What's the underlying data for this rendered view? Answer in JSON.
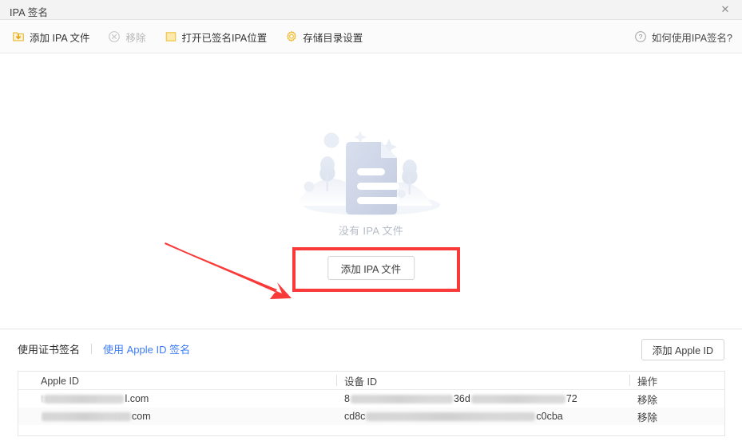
{
  "window": {
    "title": "IPA 签名",
    "close_label": "✕"
  },
  "toolbar": {
    "items": [
      {
        "label": "添加 IPA 文件",
        "icon": "import-file-icon",
        "disabled": false
      },
      {
        "label": "移除",
        "icon": "remove-circle-icon",
        "disabled": true
      },
      {
        "label": "打开已签名IPA位置",
        "icon": "folder-icon",
        "disabled": false
      },
      {
        "label": "存储目录设置",
        "icon": "gear-icon",
        "disabled": false
      }
    ],
    "help": {
      "label": "如何使用IPA签名?",
      "icon": "question-circle-icon"
    }
  },
  "empty_state": {
    "illustration": "empty-document-illustration",
    "message": "没有 IPA 文件",
    "add_button": "添加 IPA 文件"
  },
  "annotations": {
    "box_color": "#f93a39",
    "arrow_color": "#f93a39"
  },
  "bottom": {
    "tabs": [
      {
        "label": "使用证书签名",
        "active": false
      },
      {
        "label": "使用 Apple ID 签名",
        "active": true
      }
    ],
    "add_apple_id_button": "添加 Apple ID",
    "table": {
      "columns": [
        "Apple ID",
        "设备 ID",
        "操作"
      ],
      "rows": [
        {
          "apple_id_prefix": "",
          "apple_id_suffix": "l.com",
          "apple_id_redacted": true,
          "device_id_prefix": "8",
          "device_id_mid": "36d",
          "device_id_suffix": "72",
          "action": "移除"
        },
        {
          "apple_id_prefix": "",
          "apple_id_suffix": "com",
          "apple_id_redacted": true,
          "device_id_prefix": "cd8c",
          "device_id_mid": "",
          "device_id_suffix": "c0cba",
          "action": "移除"
        }
      ]
    }
  },
  "colors": {
    "accent_yellow": "#f2b842",
    "link_blue": "#3b7cf4",
    "annotation_red": "#f93a39",
    "titlebar_bg": "#f3f3f3",
    "toolbar_bg": "#fbfbfb"
  }
}
